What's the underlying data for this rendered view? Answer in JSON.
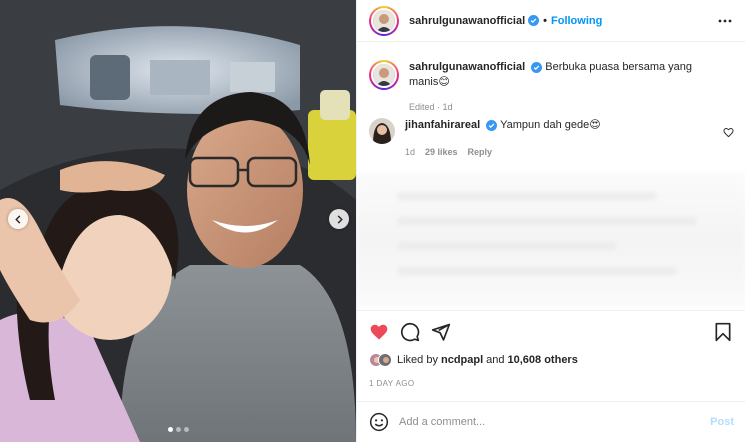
{
  "header": {
    "username": "sahrulgunawanofficial",
    "separator": "•",
    "follow_label": "Following"
  },
  "caption": {
    "username": "sahrulgunawanofficial",
    "text": "Berbuka puasa bersama yang manis😊",
    "meta": "Edited · 1d"
  },
  "comments": [
    {
      "username": "jihanfahirareal",
      "text": "Yampun dah gede😍",
      "time": "1d",
      "likes": "29 likes",
      "reply_label": "Reply"
    }
  ],
  "likes": {
    "prefix": "Liked by",
    "user": "ncdpapl",
    "middle": "and",
    "count": "10,608 others"
  },
  "date": "1 DAY AGO",
  "composer": {
    "placeholder": "Add a comment...",
    "post_label": "Post"
  },
  "carousel": {
    "slides": 3,
    "active_index": 0
  },
  "colors": {
    "accent": "#0095f6",
    "liked_heart": "#ed4956",
    "post_disabled": "#b2dffc",
    "verified": "#3897f0"
  },
  "icons": [
    "more-icon",
    "verified-badge-icon",
    "heart-icon",
    "comment-icon",
    "share-icon",
    "bookmark-icon",
    "emoji-icon",
    "chevron-left-icon",
    "chevron-right-icon"
  ]
}
